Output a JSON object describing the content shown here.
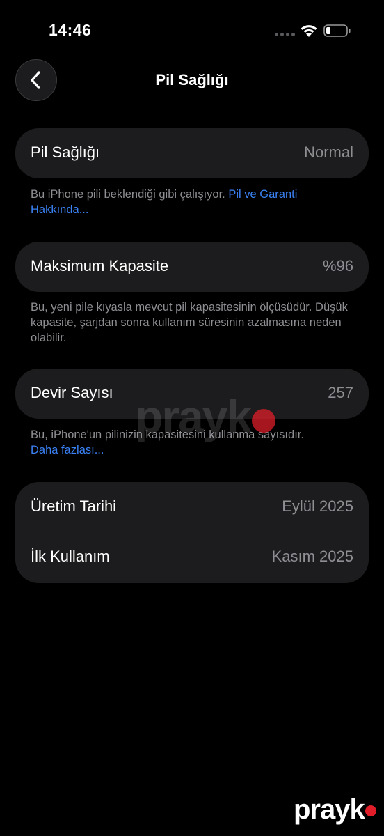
{
  "status_bar": {
    "time": "14:46"
  },
  "nav": {
    "title": "Pil Sağlığı"
  },
  "battery_health": {
    "label": "Pil Sağlığı",
    "value": "Normal",
    "note_text": "Bu iPhone pili beklendiği gibi çalışıyor. ",
    "note_link": "Pil ve Garanti Hakkında..."
  },
  "max_capacity": {
    "label": "Maksimum Kapasite",
    "value": "%96",
    "note_text": "Bu, yeni pile kıyasla mevcut pil kapasitesinin ölçüsüdür. Düşük kapasite, şarjdan sonra kullanım süresinin azalmasına neden olabilir."
  },
  "cycle_count": {
    "label": "Devir Sayısı",
    "value": "257",
    "note_text": "Bu, iPhone'un pilinizin kapasitesini kullanma sayısıdır.",
    "note_link": "Daha fazlası..."
  },
  "dates": {
    "manufacture_label": "Üretim Tarihi",
    "manufacture_value": "Eylül 2025",
    "first_use_label": "İlk Kullanım",
    "first_use_value": "Kasım 2025"
  },
  "watermark": {
    "text": "prayk"
  },
  "logo": {
    "text": "prayk"
  },
  "colors": {
    "background": "#000000",
    "card": "#1c1c1e",
    "link": "#3b82f6",
    "secondary_text": "#8e8e93",
    "brand_dot": "#e11d2a"
  }
}
